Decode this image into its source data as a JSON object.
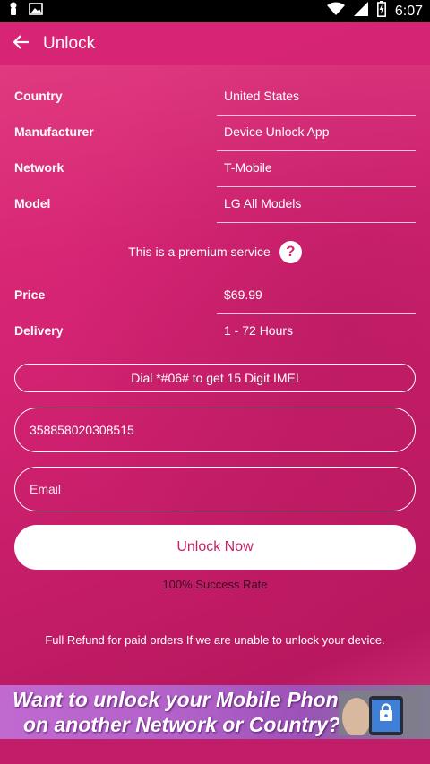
{
  "status_bar": {
    "time": "6:07"
  },
  "app_bar": {
    "title": "Unlock"
  },
  "details": [
    {
      "label": "Country",
      "value": "United States"
    },
    {
      "label": "Manufacturer",
      "value": "Device Unlock App"
    },
    {
      "label": "Network",
      "value": "T-Mobile"
    },
    {
      "label": "Model",
      "value": "LG All Models"
    }
  ],
  "premium": {
    "text": "This is a premium service",
    "help_icon": "?"
  },
  "pricing": [
    {
      "label": "Price",
      "value": "$69.99"
    },
    {
      "label": "Delivery",
      "value": "1 - 72 Hours"
    }
  ],
  "dial_hint": "Dial *#06# to get 15 Digit IMEI",
  "imei_field": {
    "value": "358858020308515"
  },
  "email_field": {
    "placeholder": "Email",
    "value": ""
  },
  "unlock_button": {
    "label": "Unlock Now"
  },
  "success_rate": "100% Success Rate",
  "refund_note": "Full Refund for paid orders If we are unable to unlock your device.",
  "banner": {
    "line1": "Want to unlock your Mobile Phone",
    "line2": "on another Network or Country?"
  },
  "colors": {
    "accent": "#d62474",
    "button_text": "#c62267"
  }
}
